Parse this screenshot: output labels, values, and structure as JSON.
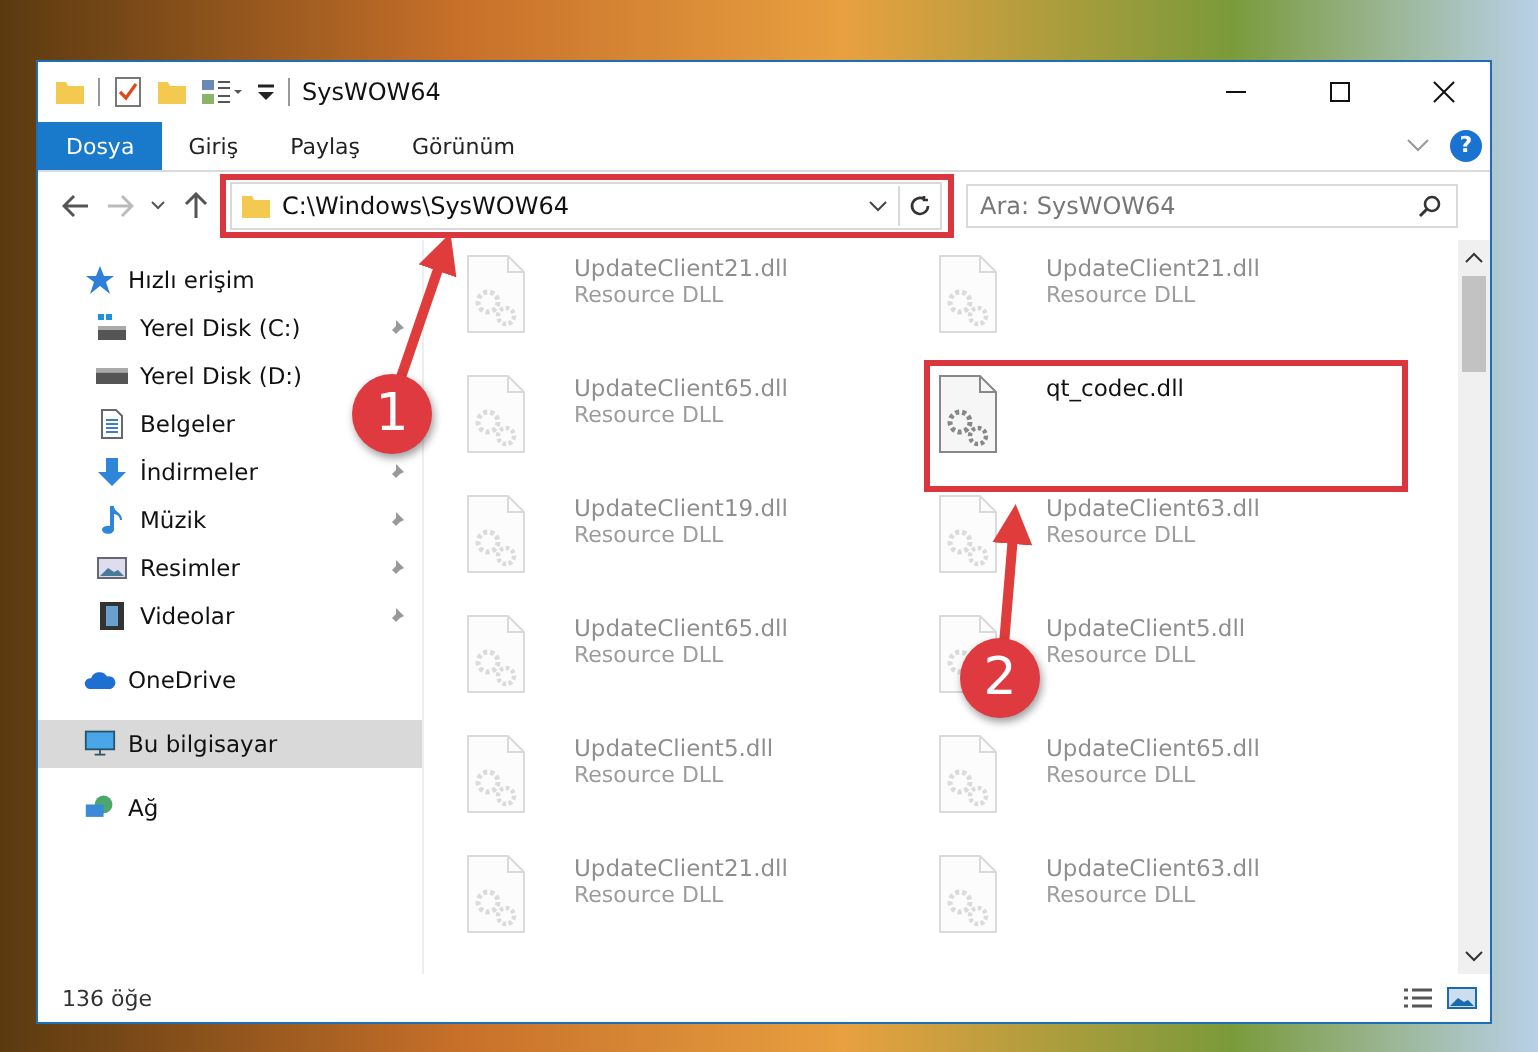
{
  "window": {
    "title": "SysWOW64"
  },
  "ribbon": {
    "tabs": [
      {
        "label": "Dosya",
        "selected": true
      },
      {
        "label": "Giriş",
        "selected": false
      },
      {
        "label": "Paylaş",
        "selected": false
      },
      {
        "label": "Görünüm",
        "selected": false
      }
    ],
    "help": "?"
  },
  "address_bar": {
    "path": "C:\\Windows\\SysWOW64"
  },
  "search": {
    "placeholder": "Ara: SysWOW64"
  },
  "sidebar": {
    "items": [
      {
        "label": "Hızlı erişim",
        "kind": "star",
        "selected": false,
        "children": [
          {
            "label": "Yerel Disk (C:)",
            "kind": "system-drive",
            "pinned": true,
            "selected": false
          },
          {
            "label": "Yerel Disk (D:)",
            "kind": "drive",
            "pinned": false,
            "selected": false
          },
          {
            "label": "Belgeler",
            "kind": "documents",
            "pinned": false,
            "selected": false
          },
          {
            "label": "İndirmeler",
            "kind": "downloads",
            "pinned": true,
            "selected": false
          },
          {
            "label": "Müzik",
            "kind": "music",
            "pinned": true,
            "selected": false
          },
          {
            "label": "Resimler",
            "kind": "pictures",
            "pinned": true,
            "selected": false
          },
          {
            "label": "Videolar",
            "kind": "videos",
            "pinned": true,
            "selected": false
          }
        ]
      },
      {
        "label": "OneDrive",
        "kind": "cloud",
        "selected": false
      },
      {
        "label": "Bu bilgisayar",
        "kind": "computer",
        "selected": true
      },
      {
        "label": "Ağ",
        "kind": "network",
        "selected": false
      }
    ]
  },
  "files": [
    {
      "name": "UpdateClient21.dll",
      "type": "Resource DLL",
      "dimmed": true
    },
    {
      "name": "UpdateClient21.dll",
      "type": "Resource DLL",
      "dimmed": true
    },
    {
      "name": "UpdateClient65.dll",
      "type": "Resource DLL",
      "dimmed": true
    },
    {
      "name": "qt_codec.dll",
      "dimmed": false
    },
    {
      "name": "UpdateClient19.dll",
      "type": "Resource DLL",
      "dimmed": true
    },
    {
      "name": "UpdateClient63.dll",
      "type": "Resource DLL",
      "dimmed": true
    },
    {
      "name": "UpdateClient65.dll",
      "type": "Resource DLL",
      "dimmed": true
    },
    {
      "name": "UpdateClient5.dll",
      "type": "Resource DLL",
      "dimmed": true
    },
    {
      "name": "UpdateClient5.dll",
      "type": "Resource DLL",
      "dimmed": true
    },
    {
      "name": "UpdateClient65.dll",
      "type": "Resource DLL",
      "dimmed": true
    },
    {
      "name": "UpdateClient21.dll",
      "type": "Resource DLL",
      "dimmed": true
    },
    {
      "name": "UpdateClient63.dll",
      "type": "Resource DLL",
      "dimmed": true
    }
  ],
  "status_bar": {
    "item_count": "136 öğe"
  },
  "callouts": [
    {
      "label": "1"
    },
    {
      "label": "2"
    }
  ]
}
